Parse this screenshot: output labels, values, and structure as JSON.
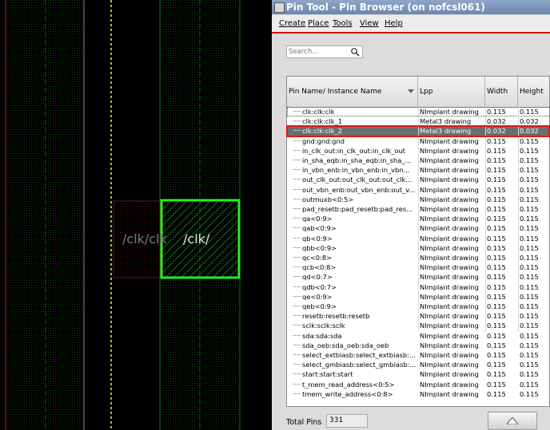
{
  "layout_view": {
    "label_dim": "/clk/clk",
    "label_bright": "/clk/",
    "colors": {
      "background": "#000000",
      "highlight": "#22ee22",
      "pin_fill": "#1f7a1f",
      "dim_pin": "#7a1818",
      "boundary_red": "#c81e1e",
      "boundary_yellow": "#f0f040"
    }
  },
  "window": {
    "title": "Pin Tool - Pin Browser (on nofcsl061)",
    "menu": [
      "Create",
      "Place",
      "Tools",
      "View",
      "Help"
    ],
    "search_placeholder": "Search...",
    "search_icon": "magnifier-icon",
    "columns": [
      "Pin Name/ Instance Name",
      "Lpp",
      "Width",
      "Height"
    ],
    "rows": [
      {
        "name": "clk:clk:clk",
        "lpp": "NImplant drawing",
        "width": "0.115",
        "height": "0.115"
      },
      {
        "name": "clk:clk:clk_1",
        "lpp": "Metal3 drawing",
        "width": "0.032",
        "height": "0.032"
      },
      {
        "name": "clk:clk:clk_2",
        "lpp": "Metal3 drawing",
        "width": "0.032",
        "height": "0.032",
        "selected": true
      },
      {
        "name": "gnd:gnd:gnd",
        "lpp": "NImplant drawing",
        "width": "0.115",
        "height": "0.115"
      },
      {
        "name": "in_clk_out:in_clk_out:in_clk_out",
        "lpp": "NImplant drawing",
        "width": "0.115",
        "height": "0.115"
      },
      {
        "name": "in_sha_eqb:in_sha_eqb:in_sha_...",
        "lpp": "NImplant drawing",
        "width": "0.115",
        "height": "0.115"
      },
      {
        "name": "in_vbn_enb:in_vbn_enb:in_vbn...",
        "lpp": "NImplant drawing",
        "width": "0.115",
        "height": "0.115"
      },
      {
        "name": "out_clk_out:out_clk_out:out_clk...",
        "lpp": "NImplant drawing",
        "width": "0.115",
        "height": "0.115"
      },
      {
        "name": "out_vbn_enb:out_vbn_enb:out_v...",
        "lpp": "NImplant drawing",
        "width": "0.115",
        "height": "0.115"
      },
      {
        "name": "outmuxb<0:5>",
        "lpp": "NImplant drawing",
        "width": "0.115",
        "height": "0.115"
      },
      {
        "name": "pad_resetb:pad_resetb:pad_res...",
        "lpp": "NImplant drawing",
        "width": "0.115",
        "height": "0.115"
      },
      {
        "name": "qa<0:9>",
        "lpp": "NImplant drawing",
        "width": "0.115",
        "height": "0.115"
      },
      {
        "name": "qab<0:9>",
        "lpp": "NImplant drawing",
        "width": "0.115",
        "height": "0.115"
      },
      {
        "name": "qb<0:9>",
        "lpp": "NImplant drawing",
        "width": "0.115",
        "height": "0.115"
      },
      {
        "name": "qbb<0:9>",
        "lpp": "NImplant drawing",
        "width": "0.115",
        "height": "0.115"
      },
      {
        "name": "qc<0:8>",
        "lpp": "NImplant drawing",
        "width": "0.115",
        "height": "0.115"
      },
      {
        "name": "qcb<0:8>",
        "lpp": "NImplant drawing",
        "width": "0.115",
        "height": "0.115"
      },
      {
        "name": "qd<0:7>",
        "lpp": "NImplant drawing",
        "width": "0.115",
        "height": "0.115"
      },
      {
        "name": "qdb<0:7>",
        "lpp": "NImplant drawing",
        "width": "0.115",
        "height": "0.115"
      },
      {
        "name": "qe<0:9>",
        "lpp": "NImplant drawing",
        "width": "0.115",
        "height": "0.115"
      },
      {
        "name": "qeb<0:9>",
        "lpp": "NImplant drawing",
        "width": "0.115",
        "height": "0.115"
      },
      {
        "name": "resetb:resetb:resetb",
        "lpp": "NImplant drawing",
        "width": "0.115",
        "height": "0.115"
      },
      {
        "name": "sclk:sclk:sclk",
        "lpp": "NImplant drawing",
        "width": "0.115",
        "height": "0.115"
      },
      {
        "name": "sda:sda:sda",
        "lpp": "NImplant drawing",
        "width": "0.115",
        "height": "0.115"
      },
      {
        "name": "sda_oeb:sda_oeb:sda_oeb",
        "lpp": "NImplant drawing",
        "width": "0.115",
        "height": "0.115"
      },
      {
        "name": "select_extbiasb:select_extbiasb:...",
        "lpp": "NImplant drawing",
        "width": "0.115",
        "height": "0.115"
      },
      {
        "name": "select_gmbiasb:select_gmbiasb:...",
        "lpp": "NImplant drawing",
        "width": "0.115",
        "height": "0.115"
      },
      {
        "name": "start:start:start",
        "lpp": "NImplant drawing",
        "width": "0.115",
        "height": "0.115"
      },
      {
        "name": "t_mem_read_address<0:5>",
        "lpp": "NImplant drawing",
        "width": "0.115",
        "height": "0.115"
      },
      {
        "name": "tmem_write_address<0:8>",
        "lpp": "NImplant drawing",
        "width": "0.115",
        "height": "0.115"
      }
    ],
    "total_label": "Total Pins",
    "total_value": "331",
    "up_button_icon": "triangle-up-icon"
  }
}
